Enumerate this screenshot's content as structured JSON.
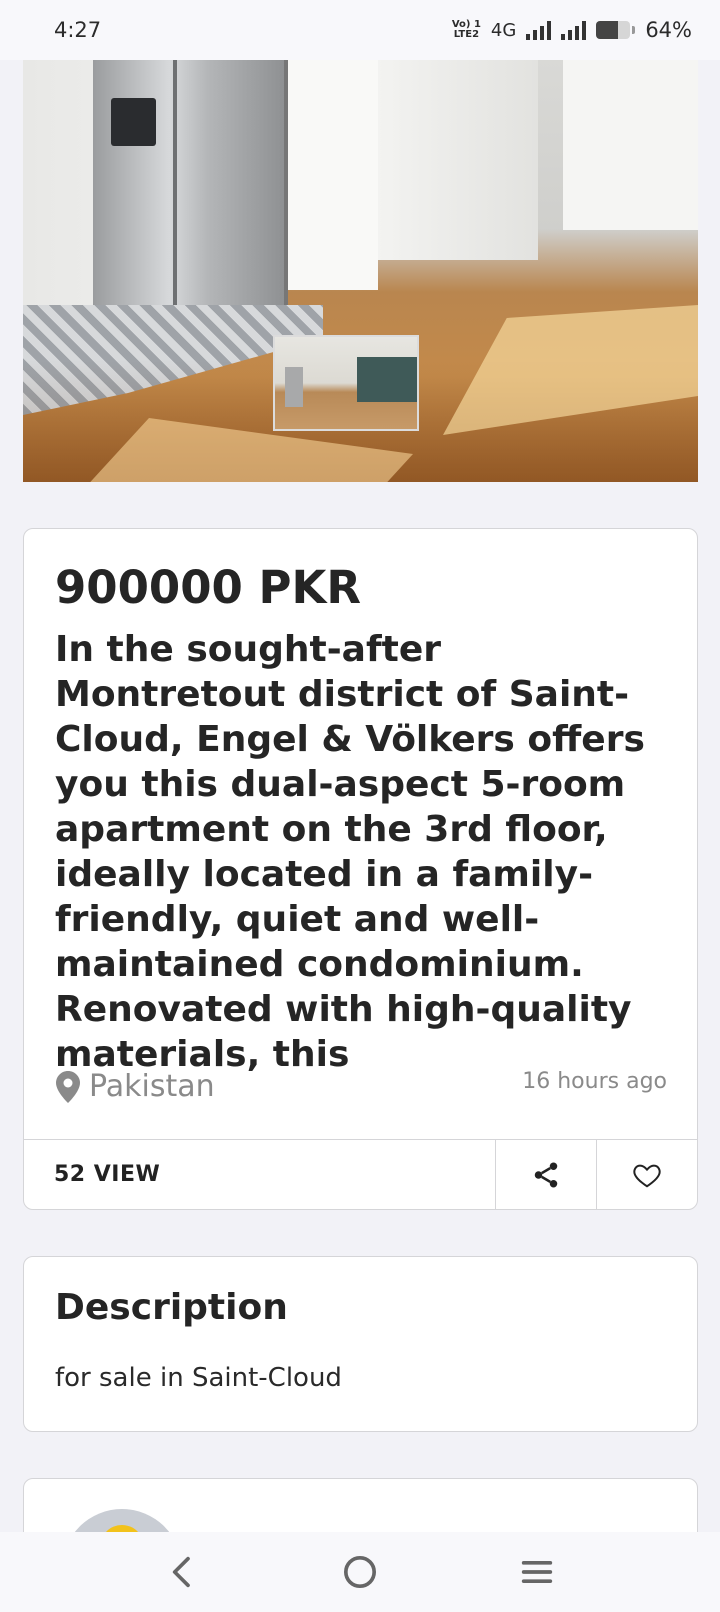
{
  "status_bar": {
    "time": "4:27",
    "volte_top": "Vo) 1",
    "volte_bottom": "LTE2",
    "network": "4G",
    "battery_percent": "64%",
    "battery_level": 0.64
  },
  "listing": {
    "price": "900000 PKR",
    "title": "In the sought-after Montretout district of Saint-Cloud, Engel & Völkers offers you this dual-aspect 5-room apartment on the 3rd floor, ideally located in a family-friendly, quiet and well-maintained condominium. Renovated with high-quality materials, this",
    "location": "Pakistan",
    "posted": "16 hours ago",
    "views": "52 VIEW"
  },
  "description": {
    "heading": "Description",
    "body": "for sale in Saint-Cloud"
  },
  "icons": {
    "location": "map-pin-icon",
    "share": "share-icon",
    "favorite": "heart-icon",
    "back": "back-chevron-icon",
    "home": "home-circle-icon",
    "menu": "menu-lines-icon"
  },
  "colors": {
    "background": "#f2f2f7",
    "card": "#ffffff",
    "text": "#252525",
    "muted": "#8a8a8a",
    "border": "#d5d5d8"
  }
}
